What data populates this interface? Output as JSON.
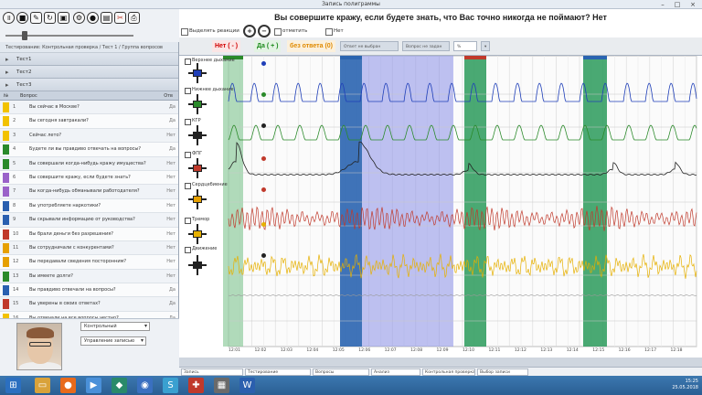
{
  "window": {
    "title": "Запись полиграммы"
  },
  "question": {
    "text": "Вы совершите кражу, если будете знать, что Вас точно никогда не поймают? Нет"
  },
  "options": {
    "checkbox1": "Выделять реакции",
    "checkbox2": "отметить",
    "checkbox3": "Нет"
  },
  "answers": {
    "no": "Нет ( - )",
    "yes": "Да ( + )",
    "none": "без ответа (0)",
    "tabs": [
      "Ответ не выбран",
      "Вопрос не задан"
    ],
    "percent": "%"
  },
  "left": {
    "path": "Тестирование: Контрольная проверка / Тест 1 / Группа вопросов",
    "sections": [
      "Тест1",
      "Тест2",
      "Тест3"
    ],
    "qhead": {
      "num": "№",
      "text": "Вопрос",
      "end": "Отв"
    },
    "questions": [
      {
        "code": "1",
        "text": "Вы сейчас в Москве?",
        "tag": "Да",
        "color": "#f2c200"
      },
      {
        "code": "2",
        "text": "Вы сегодня завтракали?",
        "tag": "Да",
        "color": "#f2c200"
      },
      {
        "code": "3",
        "text": "Сейчас лето?",
        "tag": "Нет",
        "color": "#f2c200"
      },
      {
        "code": "4",
        "text": "Будете ли вы правдиво отвечать на вопросы?",
        "tag": "Да",
        "color": "#2a8a2a"
      },
      {
        "code": "5",
        "text": "Вы совершали когда-нибудь кражу имущества?",
        "tag": "Нет",
        "color": "#2a8a2a"
      },
      {
        "code": "6",
        "text": "Вы совершите кражу, если будете знать?",
        "tag": "Нет",
        "color": "#9a62c9"
      },
      {
        "code": "7",
        "text": "Вы когда-нибудь обманывали работодателя?",
        "tag": "Нет",
        "color": "#9a62c9"
      },
      {
        "code": "8",
        "text": "Вы употребляете наркотики?",
        "tag": "Нет",
        "color": "#2a5fb0"
      },
      {
        "code": "9",
        "text": "Вы скрывали информацию от руководства?",
        "tag": "Нет",
        "color": "#2a5fb0"
      },
      {
        "code": "10",
        "text": "Вы брали деньги без разрешения?",
        "tag": "Нет",
        "color": "#c0392b"
      },
      {
        "code": "11",
        "text": "Вы сотрудничали с конкурентами?",
        "tag": "Нет",
        "color": "#e6a000"
      },
      {
        "code": "12",
        "text": "Вы передавали сведения посторонним?",
        "tag": "Нет",
        "color": "#e6a000"
      },
      {
        "code": "13",
        "text": "Вы имеете долги?",
        "tag": "Нет",
        "color": "#2a8a2a"
      },
      {
        "code": "14",
        "text": "Вы правдиво отвечали на вопросы?",
        "tag": "Да",
        "color": "#2a5fb0"
      },
      {
        "code": "15",
        "text": "Вы уверены в своих ответах?",
        "tag": "Да",
        "color": "#c0392b"
      },
      {
        "code": "16",
        "text": "Вы отвечали на все вопросы честно?",
        "tag": "Да",
        "color": "#f2c200"
      }
    ],
    "dropdown1": "Контрольный",
    "dropdown2": "Управление записью"
  },
  "channels": [
    {
      "label": "Верхнее дыхание",
      "color": "#1f3fb8",
      "ctrlcolor": "#1f3fb8"
    },
    {
      "label": "Нижнее дыхание",
      "color": "#2a8a2a",
      "ctrlcolor": "#2a8a2a"
    },
    {
      "label": "КГР",
      "color": "#222222",
      "ctrlcolor": "#222222"
    },
    {
      "label": "ФПГ",
      "color": "#c0392b",
      "ctrlcolor": "#c0392b"
    },
    {
      "label": "Сердцебиение",
      "color": "#c0392b",
      "ctrlcolor": "#e6a000"
    },
    {
      "label": "Тремор",
      "color": "#e6b000",
      "ctrlcolor": "#e6b000"
    },
    {
      "label": "Движение",
      "color": "#222222",
      "ctrlcolor": "#222222"
    }
  ],
  "timeline": [
    "12:01",
    "12:02",
    "12:03",
    "12:04",
    "12:05",
    "12:06",
    "12:07",
    "12:08",
    "12:09",
    "12:10",
    "12:11",
    "12:12",
    "12:13",
    "12:14",
    "12:15",
    "12:16",
    "12:17",
    "12:18"
  ],
  "statusbar": [
    "Запись",
    "Тестирование",
    "Вопросы",
    "Анализ",
    "Контрольная проверка",
    "Выбор записи"
  ],
  "tray": {
    "time": "15:25",
    "date": "25.05.2018"
  }
}
